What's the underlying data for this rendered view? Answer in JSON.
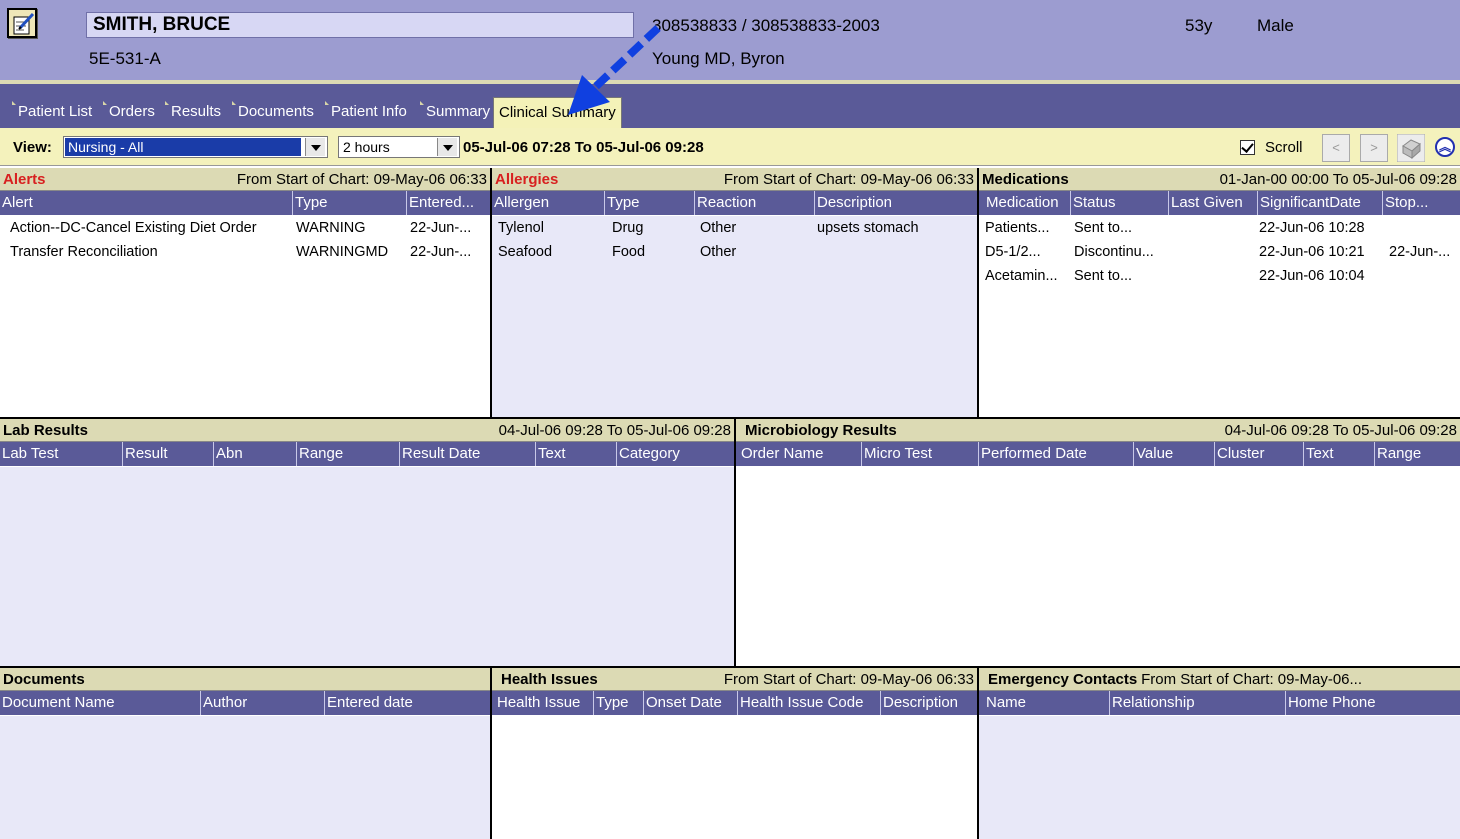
{
  "header": {
    "patient_name": "SMITH, BRUCE",
    "location": "5E-531-A",
    "mrn": "308538833 / 308538833-2003",
    "physician": "Young  MD, Byron",
    "age": "53y",
    "sex": "Male"
  },
  "tabs": [
    "Patient List",
    "Orders",
    "Results",
    "Documents",
    "Patient Info",
    "Summary",
    "Clinical Summary"
  ],
  "active_tab": "Clinical Summary",
  "toolbar": {
    "view_label": "View:",
    "view_value": "Nursing - All",
    "hours_value": "2 hours",
    "date_range": "05-Jul-06 07:28 To 05-Jul-06 09:28",
    "scroll_label": "Scroll",
    "scroll_checked": true,
    "prev_label": "<",
    "next_label": ">"
  },
  "panels": {
    "alerts": {
      "title": "Alerts",
      "range": "From Start of Chart: 09-May-06 06:33",
      "columns": [
        "Alert",
        "Type",
        "Entered..."
      ],
      "rows": [
        [
          "Action--DC-Cancel Existing Diet Order",
          "WARNING",
          "22-Jun-..."
        ],
        [
          "Transfer Reconciliation",
          "WARNINGMD",
          "22-Jun-..."
        ]
      ]
    },
    "allergies": {
      "title": "Allergies",
      "range": "From Start of Chart: 09-May-06 06:33",
      "columns": [
        "Allergen",
        "Type",
        "Reaction",
        "Description"
      ],
      "rows": [
        [
          "Tylenol",
          "Drug",
          "Other",
          "upsets stomach"
        ],
        [
          "Seafood",
          "Food",
          "Other",
          ""
        ]
      ]
    },
    "medications": {
      "title": "Medications",
      "range": "01-Jan-00 00:00 To 05-Jul-06 09:28",
      "columns": [
        "Medication",
        "Status",
        "Last Given",
        "SignificantDate",
        "Stop..."
      ],
      "rows": [
        [
          "Patients...",
          "Sent to...",
          "",
          "22-Jun-06 10:28",
          ""
        ],
        [
          "D5-1/2...",
          "Discontinu...",
          "",
          "22-Jun-06 10:21",
          "22-Jun-..."
        ],
        [
          "Acetamin...",
          "Sent to...",
          "",
          "22-Jun-06 10:04",
          ""
        ]
      ]
    },
    "lab_results": {
      "title": "Lab Results",
      "range": "04-Jul-06 09:28 To 05-Jul-06 09:28",
      "columns": [
        "Lab Test",
        "Result",
        "Abn",
        "Range",
        "Result Date",
        "Text",
        "Category"
      ]
    },
    "micro_results": {
      "title": "Microbiology Results",
      "range": "04-Jul-06 09:28 To 05-Jul-06 09:28",
      "columns": [
        "Order Name",
        "Micro Test",
        "Performed Date",
        "Value",
        "Cluster",
        "Text",
        "Range"
      ]
    },
    "documents": {
      "title": "Documents",
      "range": "",
      "columns": [
        "Document Name",
        "Author",
        "Entered date"
      ]
    },
    "health_issues": {
      "title": "Health Issues",
      "range": "From Start of Chart: 09-May-06 06:33",
      "columns": [
        "Health Issue",
        "Type",
        "Onset Date",
        "Health Issue Code",
        "Description"
      ]
    },
    "emergency_contacts": {
      "title": "Emergency Contacts",
      "range": "From Start of Chart: 09-May-06...",
      "columns": [
        "Name",
        "Relationship",
        "Home Phone"
      ]
    }
  },
  "colors": {
    "header_bg": "#9c9cd0",
    "tabbar_bg": "#5a5a98",
    "toolbar_bg": "#f4f2bc",
    "panel_title_bg": "#dcdab4",
    "alert_title_color": "#d82020",
    "arrow_color": "#1040e0"
  }
}
